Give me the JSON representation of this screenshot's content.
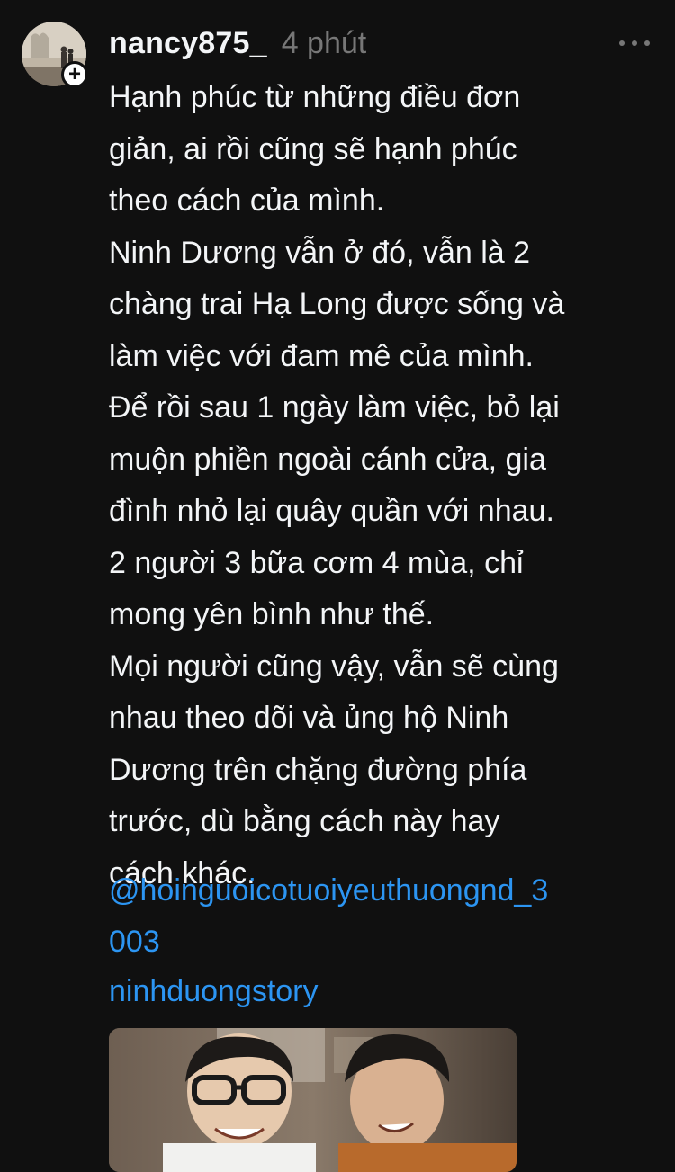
{
  "post": {
    "username": "nancy875_",
    "time": "4 phút",
    "body_lines": [
      "Hạnh phúc từ những điều đơn",
      "giản, ai rồi cũng sẽ hạnh phúc",
      "theo cách của mình.",
      "Ninh Dương vẫn ở đó, vẫn là 2",
      "chàng trai Hạ Long được sống và",
      "làm việc với đam mê của mình.",
      "Để rồi sau 1 ngày làm việc, bỏ lại",
      "muộn phiền ngoài cánh cửa, gia",
      "đình nhỏ lại quây quần với nhau.",
      "2 người 3 bữa cơm 4 mùa, chỉ",
      "mong yên bình như thế.",
      "Mọi người cũng vậy, vẫn sẽ cùng",
      "nhau theo dõi và ủng hộ Ninh",
      "Dương trên chặng đường phía",
      "trước, dù bằng cách này hay",
      "cách khác."
    ],
    "mention_lines": [
      "@hoinguoicotuoiyeuthuongnd_3",
      "003"
    ],
    "tag": "ninhduongstory"
  },
  "icons": {
    "follow": "plus-icon",
    "more": "more-horizontal-icon"
  },
  "colors": {
    "background": "#101010",
    "text": "#f3f5f7",
    "muted": "#777777",
    "link": "#2c95f2"
  }
}
